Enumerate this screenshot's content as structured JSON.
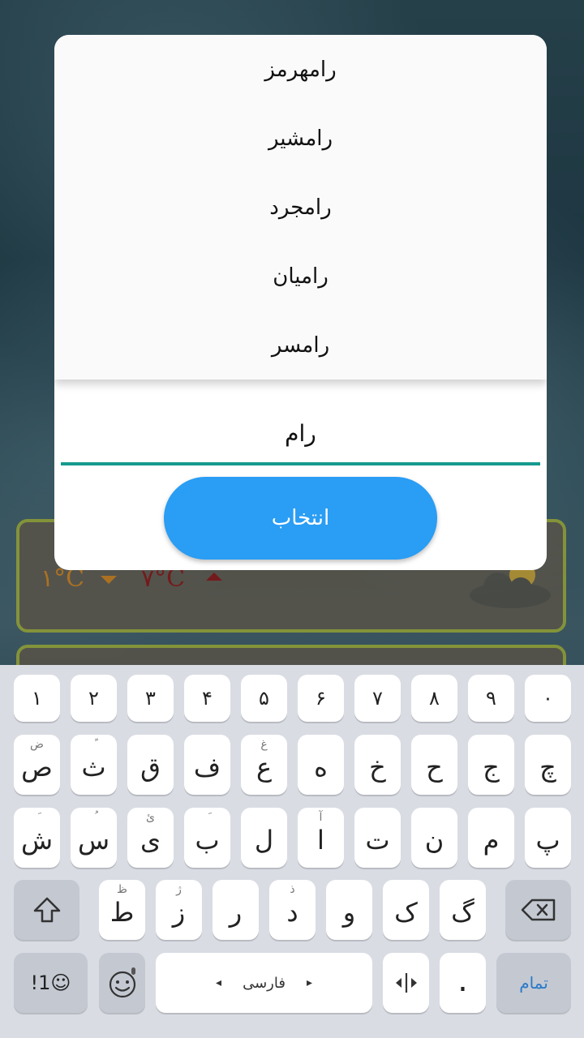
{
  "weather": {
    "temp_min": "۱°C",
    "temp_max": "۷°C"
  },
  "dialog": {
    "suggestions": [
      "رامهرمز",
      "رامشیر",
      "رامجرد",
      "رامیان",
      "رامسر"
    ],
    "input_value": "رام",
    "select_label": "انتخاب"
  },
  "keyboard": {
    "row1": [
      "۱",
      "۲",
      "۳",
      "۴",
      "۵",
      "۶",
      "۷",
      "۸",
      "۹",
      "۰"
    ],
    "row2": [
      {
        "main": "ص",
        "sub": "ض"
      },
      {
        "main": "ث",
        "sub": "ً"
      },
      {
        "main": "ق",
        "sub": ""
      },
      {
        "main": "ف",
        "sub": ""
      },
      {
        "main": "ع",
        "sub": "غ"
      },
      {
        "main": "ه",
        "sub": ""
      },
      {
        "main": "خ",
        "sub": ""
      },
      {
        "main": "ح",
        "sub": ""
      },
      {
        "main": "ج",
        "sub": ""
      },
      {
        "main": "چ",
        "sub": ""
      }
    ],
    "row3": [
      {
        "main": "ش",
        "sub": "َ"
      },
      {
        "main": "س",
        "sub": "ُ"
      },
      {
        "main": "ی",
        "sub": "ئ"
      },
      {
        "main": "ب",
        "sub": "َ"
      },
      {
        "main": "ل",
        "sub": ""
      },
      {
        "main": "ا",
        "sub": "آ"
      },
      {
        "main": "ت",
        "sub": ""
      },
      {
        "main": "ن",
        "sub": ""
      },
      {
        "main": "م",
        "sub": ""
      },
      {
        "main": "پ",
        "sub": ""
      }
    ],
    "row4": [
      {
        "main": "ط",
        "sub": "ظ"
      },
      {
        "main": "ز",
        "sub": "ژ"
      },
      {
        "main": "ر",
        "sub": ""
      },
      {
        "main": "د",
        "sub": "ذ"
      },
      {
        "main": "و",
        "sub": ""
      },
      {
        "main": "ک",
        "sub": ""
      },
      {
        "main": "گ",
        "sub": ""
      }
    ],
    "symbols_label": "!1☺",
    "space_label": "فارسی",
    "period_label": ".",
    "done_label": "تمام"
  }
}
